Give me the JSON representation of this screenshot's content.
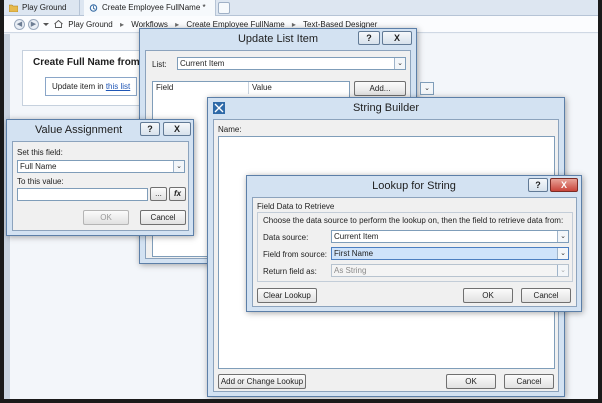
{
  "tabs": [
    {
      "label": "Play Ground",
      "active": false
    },
    {
      "label": "Create Employee FullName *",
      "active": true
    }
  ],
  "breadcrumbs": [
    "Play Ground",
    "Workflows",
    "Create Employee FullName",
    "Text-Based Designer"
  ],
  "designer": {
    "title": "Create Full Name from Fi",
    "step_text": "Update item in ",
    "step_link": "this list"
  },
  "update_list_item": {
    "title": "Update List Item",
    "help_label": "?",
    "close_label": "X",
    "list_label": "List:",
    "list_value": "Current Item",
    "col_field": "Field",
    "col_value": "Value",
    "add_label": "Add..."
  },
  "value_assignment": {
    "title": "Value Assignment",
    "help_label": "?",
    "close_label": "X",
    "set_label": "Set this field:",
    "set_value": "Full Name",
    "to_label": "To this value:",
    "to_value": "",
    "ellipsis_label": "...",
    "fx_label": "fx",
    "ok_label": "OK",
    "cancel_label": "Cancel"
  },
  "string_builder": {
    "title": "String Builder",
    "help_label": "?",
    "close_label": "X",
    "name_label": "Name:",
    "add_change_label": "Add or Change Lookup",
    "ok_label": "OK",
    "cancel_label": "Cancel"
  },
  "lookup": {
    "title": "Lookup for String",
    "help_label": "?",
    "close_label": "X",
    "group_label": "Field Data to Retrieve",
    "instruction": "Choose the data source to perform the lookup on, then the field to retrieve data from:",
    "data_source_label": "Data source:",
    "data_source_value": "Current Item",
    "field_from_source_label": "Field from source:",
    "field_from_source_value": "First Name",
    "return_field_label": "Return field as:",
    "return_field_value": "As String",
    "clear_label": "Clear Lookup",
    "ok_label": "OK",
    "cancel_label": "Cancel"
  },
  "colors": {
    "dialog_chrome": "#d3e2f2",
    "close_red": "#c9453a",
    "link": "#1f56b6",
    "selection": "#cfe3fa"
  }
}
